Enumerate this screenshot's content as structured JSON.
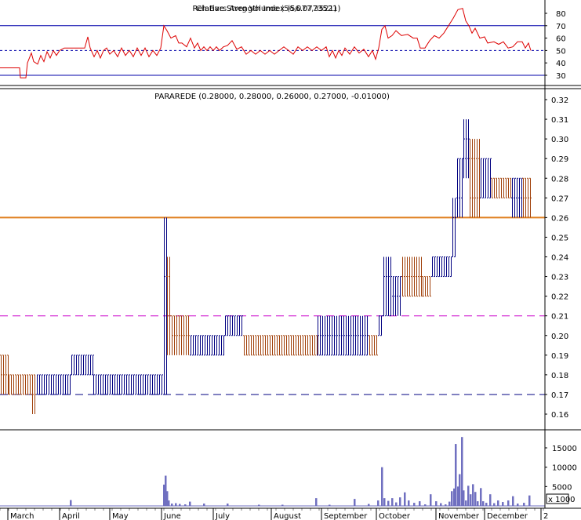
{
  "colors": {
    "background": "#ffffff",
    "frame": "#000000",
    "up_bar": "#000080",
    "down_bar": "#a0400a",
    "rsi_line": "#dd0000",
    "rsi_level": "#0000aa",
    "resistance": "#e08020",
    "dash_magenta": "#cc00cc",
    "dash_navy": "#000080",
    "volume": "#7070c0"
  },
  "chart_data": [
    {
      "id": "rsi",
      "type": "line",
      "title": "Relative Strength Index (56.0773521)",
      "title_overlay": "Ch Bars Avrg Volume (56,077,3521)",
      "y_ticks": [
        "80",
        "70",
        "60",
        "50",
        "40",
        "30"
      ],
      "ylim": [
        22,
        90
      ],
      "levels": {
        "upper": 70,
        "mid": 50,
        "lower": 30
      },
      "series": [
        {
          "x": 0,
          "y": 36
        },
        {
          "x": 25,
          "y": 36
        },
        {
          "x": 26,
          "y": 28
        },
        {
          "x": 33,
          "y": 28
        },
        {
          "x": 35,
          "y": 40
        },
        {
          "x": 40,
          "y": 48
        },
        {
          "x": 43,
          "y": 41
        },
        {
          "x": 48,
          "y": 39
        },
        {
          "x": 52,
          "y": 46
        },
        {
          "x": 56,
          "y": 41
        },
        {
          "x": 60,
          "y": 49
        },
        {
          "x": 64,
          "y": 44
        },
        {
          "x": 68,
          "y": 50
        },
        {
          "x": 72,
          "y": 46
        },
        {
          "x": 76,
          "y": 50
        },
        {
          "x": 82,
          "y": 52
        },
        {
          "x": 90,
          "y": 52
        },
        {
          "x": 96,
          "y": 52
        },
        {
          "x": 103,
          "y": 52
        },
        {
          "x": 108,
          "y": 52
        },
        {
          "x": 112,
          "y": 61
        },
        {
          "x": 115,
          "y": 52
        },
        {
          "x": 120,
          "y": 45
        },
        {
          "x": 124,
          "y": 50
        },
        {
          "x": 128,
          "y": 44
        },
        {
          "x": 132,
          "y": 50
        },
        {
          "x": 136,
          "y": 52
        },
        {
          "x": 140,
          "y": 47
        },
        {
          "x": 145,
          "y": 50
        },
        {
          "x": 150,
          "y": 45
        },
        {
          "x": 155,
          "y": 52
        },
        {
          "x": 160,
          "y": 46
        },
        {
          "x": 165,
          "y": 50
        },
        {
          "x": 170,
          "y": 45
        },
        {
          "x": 175,
          "y": 52
        },
        {
          "x": 180,
          "y": 46
        },
        {
          "x": 185,
          "y": 52
        },
        {
          "x": 190,
          "y": 45
        },
        {
          "x": 195,
          "y": 50
        },
        {
          "x": 200,
          "y": 46
        },
        {
          "x": 205,
          "y": 52
        },
        {
          "x": 209,
          "y": 70
        },
        {
          "x": 213,
          "y": 66
        },
        {
          "x": 218,
          "y": 60
        },
        {
          "x": 224,
          "y": 62
        },
        {
          "x": 228,
          "y": 56
        },
        {
          "x": 232,
          "y": 56
        },
        {
          "x": 238,
          "y": 53
        },
        {
          "x": 243,
          "y": 60
        },
        {
          "x": 248,
          "y": 52
        },
        {
          "x": 252,
          "y": 56
        },
        {
          "x": 256,
          "y": 50
        },
        {
          "x": 260,
          "y": 53
        },
        {
          "x": 264,
          "y": 50
        },
        {
          "x": 268,
          "y": 53
        },
        {
          "x": 272,
          "y": 50
        },
        {
          "x": 276,
          "y": 53
        },
        {
          "x": 280,
          "y": 50
        },
        {
          "x": 285,
          "y": 53
        },
        {
          "x": 290,
          "y": 54
        },
        {
          "x": 296,
          "y": 58
        },
        {
          "x": 302,
          "y": 51
        },
        {
          "x": 308,
          "y": 53
        },
        {
          "x": 314,
          "y": 47
        },
        {
          "x": 320,
          "y": 50
        },
        {
          "x": 326,
          "y": 47
        },
        {
          "x": 332,
          "y": 50
        },
        {
          "x": 338,
          "y": 47
        },
        {
          "x": 344,
          "y": 50
        },
        {
          "x": 350,
          "y": 47
        },
        {
          "x": 356,
          "y": 50
        },
        {
          "x": 362,
          "y": 53
        },
        {
          "x": 368,
          "y": 50
        },
        {
          "x": 374,
          "y": 47
        },
        {
          "x": 380,
          "y": 53
        },
        {
          "x": 386,
          "y": 50
        },
        {
          "x": 392,
          "y": 53
        },
        {
          "x": 398,
          "y": 50
        },
        {
          "x": 404,
          "y": 53
        },
        {
          "x": 410,
          "y": 50
        },
        {
          "x": 416,
          "y": 53
        },
        {
          "x": 420,
          "y": 45
        },
        {
          "x": 424,
          "y": 50
        },
        {
          "x": 428,
          "y": 44
        },
        {
          "x": 432,
          "y": 50
        },
        {
          "x": 436,
          "y": 46
        },
        {
          "x": 440,
          "y": 52
        },
        {
          "x": 446,
          "y": 47
        },
        {
          "x": 452,
          "y": 53
        },
        {
          "x": 458,
          "y": 48
        },
        {
          "x": 464,
          "y": 51
        },
        {
          "x": 470,
          "y": 45
        },
        {
          "x": 475,
          "y": 50
        },
        {
          "x": 479,
          "y": 43
        },
        {
          "x": 483,
          "y": 52
        },
        {
          "x": 487,
          "y": 67
        },
        {
          "x": 491,
          "y": 70
        },
        {
          "x": 495,
          "y": 60
        },
        {
          "x": 500,
          "y": 62
        },
        {
          "x": 505,
          "y": 66
        },
        {
          "x": 512,
          "y": 62
        },
        {
          "x": 520,
          "y": 63
        },
        {
          "x": 527,
          "y": 60
        },
        {
          "x": 532,
          "y": 60
        },
        {
          "x": 536,
          "y": 52
        },
        {
          "x": 542,
          "y": 52
        },
        {
          "x": 548,
          "y": 58
        },
        {
          "x": 554,
          "y": 62
        },
        {
          "x": 560,
          "y": 60
        },
        {
          "x": 566,
          "y": 64
        },
        {
          "x": 572,
          "y": 70
        },
        {
          "x": 578,
          "y": 76
        },
        {
          "x": 584,
          "y": 83
        },
        {
          "x": 590,
          "y": 84
        },
        {
          "x": 594,
          "y": 74
        },
        {
          "x": 598,
          "y": 70
        },
        {
          "x": 602,
          "y": 64
        },
        {
          "x": 606,
          "y": 68
        },
        {
          "x": 612,
          "y": 60
        },
        {
          "x": 618,
          "y": 61
        },
        {
          "x": 622,
          "y": 56
        },
        {
          "x": 630,
          "y": 57
        },
        {
          "x": 636,
          "y": 55
        },
        {
          "x": 642,
          "y": 57
        },
        {
          "x": 648,
          "y": 52
        },
        {
          "x": 654,
          "y": 53
        },
        {
          "x": 660,
          "y": 57
        },
        {
          "x": 666,
          "y": 57
        },
        {
          "x": 670,
          "y": 52
        },
        {
          "x": 674,
          "y": 56
        },
        {
          "x": 677,
          "y": 50
        }
      ]
    },
    {
      "id": "price",
      "type": "ohlc",
      "title": "PARAREDE (0.28000, 0.28000, 0.26000, 0.27000, -0.01000)",
      "y_ticks": [
        "0.32",
        "0.31",
        "0.30",
        "0.29",
        "0.28",
        "0.27",
        "0.26",
        "0.25",
        "0.24",
        "0.23",
        "0.22",
        "0.21",
        "0.20",
        "0.19",
        "0.18",
        "0.17",
        "0.16"
      ],
      "ylim": [
        0.1525,
        0.3275
      ],
      "x_labels": [
        "March",
        "April",
        "May",
        "June",
        "July",
        "August",
        "September",
        "October",
        "November",
        "December",
        "2"
      ],
      "reference_lines": [
        {
          "value": 0.26,
          "style": "solid",
          "color_key": "resistance"
        },
        {
          "value": 0.21,
          "style": "dashed",
          "color_key": "dash_magenta"
        },
        {
          "value": 0.17,
          "style": "dashed",
          "color_key": "dash_navy"
        }
      ],
      "segments": [
        {
          "x0": 0,
          "x1": 10,
          "o": 0.19,
          "c": 0.18,
          "h": 0.19,
          "l": 0.17
        },
        {
          "x0": 10,
          "x1": 40,
          "o": 0.18,
          "c": 0.17,
          "h": 0.18,
          "l": 0.17
        },
        {
          "x0": 40,
          "x1": 46,
          "o": 0.18,
          "c": 0.17,
          "h": 0.18,
          "l": 0.16
        },
        {
          "x0": 46,
          "x1": 90,
          "o": 0.17,
          "c": 0.18,
          "h": 0.18,
          "l": 0.17
        },
        {
          "x0": 90,
          "x1": 118,
          "o": 0.18,
          "c": 0.19,
          "h": 0.19,
          "l": 0.18
        },
        {
          "x0": 118,
          "x1": 208,
          "o": 0.17,
          "c": 0.18,
          "h": 0.18,
          "l": 0.17
        },
        {
          "x0": 208,
          "x1": 212,
          "o": 0.17,
          "c": 0.23,
          "h": 0.26,
          "l": 0.17
        },
        {
          "x0": 212,
          "x1": 218,
          "o": 0.23,
          "c": 0.21,
          "h": 0.24,
          "l": 0.19
        },
        {
          "x0": 218,
          "x1": 242,
          "o": 0.21,
          "c": 0.2,
          "h": 0.21,
          "l": 0.19
        },
        {
          "x0": 242,
          "x1": 286,
          "o": 0.19,
          "c": 0.2,
          "h": 0.2,
          "l": 0.19
        },
        {
          "x0": 286,
          "x1": 310,
          "o": 0.2,
          "c": 0.21,
          "h": 0.21,
          "l": 0.2
        },
        {
          "x0": 310,
          "x1": 404,
          "o": 0.2,
          "c": 0.19,
          "h": 0.2,
          "l": 0.19
        },
        {
          "x0": 404,
          "x1": 470,
          "o": 0.19,
          "c": 0.2,
          "h": 0.21,
          "l": 0.19
        },
        {
          "x0": 470,
          "x1": 482,
          "o": 0.2,
          "c": 0.19,
          "h": 0.2,
          "l": 0.19
        },
        {
          "x0": 482,
          "x1": 488,
          "o": 0.2,
          "c": 0.21,
          "h": 0.21,
          "l": 0.2
        },
        {
          "x0": 488,
          "x1": 500,
          "o": 0.21,
          "c": 0.23,
          "h": 0.24,
          "l": 0.21
        },
        {
          "x0": 500,
          "x1": 512,
          "o": 0.22,
          "c": 0.23,
          "h": 0.23,
          "l": 0.21
        },
        {
          "x0": 512,
          "x1": 538,
          "o": 0.23,
          "c": 0.22,
          "h": 0.24,
          "l": 0.22
        },
        {
          "x0": 538,
          "x1": 550,
          "o": 0.23,
          "c": 0.22,
          "h": 0.23,
          "l": 0.22
        },
        {
          "x0": 550,
          "x1": 576,
          "o": 0.23,
          "c": 0.24,
          "h": 0.24,
          "l": 0.23
        },
        {
          "x0": 576,
          "x1": 582,
          "o": 0.24,
          "c": 0.26,
          "h": 0.27,
          "l": 0.24
        },
        {
          "x0": 582,
          "x1": 590,
          "o": 0.27,
          "c": 0.29,
          "h": 0.29,
          "l": 0.26
        },
        {
          "x0": 590,
          "x1": 598,
          "o": 0.29,
          "c": 0.3,
          "h": 0.31,
          "l": 0.28
        },
        {
          "x0": 598,
          "x1": 612,
          "o": 0.29,
          "c": 0.27,
          "h": 0.3,
          "l": 0.26
        },
        {
          "x0": 612,
          "x1": 626,
          "o": 0.27,
          "c": 0.29,
          "h": 0.29,
          "l": 0.27
        },
        {
          "x0": 626,
          "x1": 652,
          "o": 0.28,
          "c": 0.27,
          "h": 0.28,
          "l": 0.27
        },
        {
          "x0": 652,
          "x1": 666,
          "o": 0.27,
          "c": 0.28,
          "h": 0.28,
          "l": 0.26
        },
        {
          "x0": 666,
          "x1": 678,
          "o": 0.28,
          "c": 0.27,
          "h": 0.28,
          "l": 0.26
        }
      ]
    },
    {
      "id": "volume",
      "type": "bar",
      "y_ticks": [
        "15000",
        "10000",
        "5000"
      ],
      "unit_label": "x 1000",
      "ylim": [
        0,
        18500
      ],
      "values": [
        {
          "x": 90,
          "v": 1500
        },
        {
          "x": 209,
          "v": 5500
        },
        {
          "x": 211,
          "v": 7800
        },
        {
          "x": 213,
          "v": 3800
        },
        {
          "x": 215,
          "v": 1400
        },
        {
          "x": 219,
          "v": 600
        },
        {
          "x": 224,
          "v": 700
        },
        {
          "x": 229,
          "v": 500
        },
        {
          "x": 236,
          "v": 400
        },
        {
          "x": 242,
          "v": 1100
        },
        {
          "x": 260,
          "v": 600
        },
        {
          "x": 290,
          "v": 600
        },
        {
          "x": 330,
          "v": 300
        },
        {
          "x": 360,
          "v": 300
        },
        {
          "x": 403,
          "v": 2000
        },
        {
          "x": 420,
          "v": 300
        },
        {
          "x": 452,
          "v": 1800
        },
        {
          "x": 470,
          "v": 500
        },
        {
          "x": 482,
          "v": 1400
        },
        {
          "x": 487,
          "v": 10000
        },
        {
          "x": 490,
          "v": 2000
        },
        {
          "x": 495,
          "v": 1300
        },
        {
          "x": 500,
          "v": 2000
        },
        {
          "x": 505,
          "v": 900
        },
        {
          "x": 510,
          "v": 2200
        },
        {
          "x": 516,
          "v": 3500
        },
        {
          "x": 521,
          "v": 1400
        },
        {
          "x": 528,
          "v": 800
        },
        {
          "x": 535,
          "v": 1200
        },
        {
          "x": 542,
          "v": 400
        },
        {
          "x": 549,
          "v": 3000
        },
        {
          "x": 556,
          "v": 1200
        },
        {
          "x": 562,
          "v": 700
        },
        {
          "x": 568,
          "v": 400
        },
        {
          "x": 573,
          "v": 1100
        },
        {
          "x": 576,
          "v": 3800
        },
        {
          "x": 579,
          "v": 4500
        },
        {
          "x": 581,
          "v": 16000
        },
        {
          "x": 584,
          "v": 5000
        },
        {
          "x": 586,
          "v": 8200
        },
        {
          "x": 589,
          "v": 17800
        },
        {
          "x": 591,
          "v": 4000
        },
        {
          "x": 594,
          "v": 1400
        },
        {
          "x": 597,
          "v": 5200
        },
        {
          "x": 600,
          "v": 3000
        },
        {
          "x": 603,
          "v": 5600
        },
        {
          "x": 606,
          "v": 3600
        },
        {
          "x": 609,
          "v": 1200
        },
        {
          "x": 613,
          "v": 4600
        },
        {
          "x": 616,
          "v": 1200
        },
        {
          "x": 620,
          "v": 800
        },
        {
          "x": 625,
          "v": 3000
        },
        {
          "x": 630,
          "v": 700
        },
        {
          "x": 635,
          "v": 1400
        },
        {
          "x": 641,
          "v": 1000
        },
        {
          "x": 648,
          "v": 1400
        },
        {
          "x": 654,
          "v": 2500
        },
        {
          "x": 660,
          "v": 600
        },
        {
          "x": 668,
          "v": 800
        },
        {
          "x": 675,
          "v": 2700
        }
      ]
    }
  ]
}
